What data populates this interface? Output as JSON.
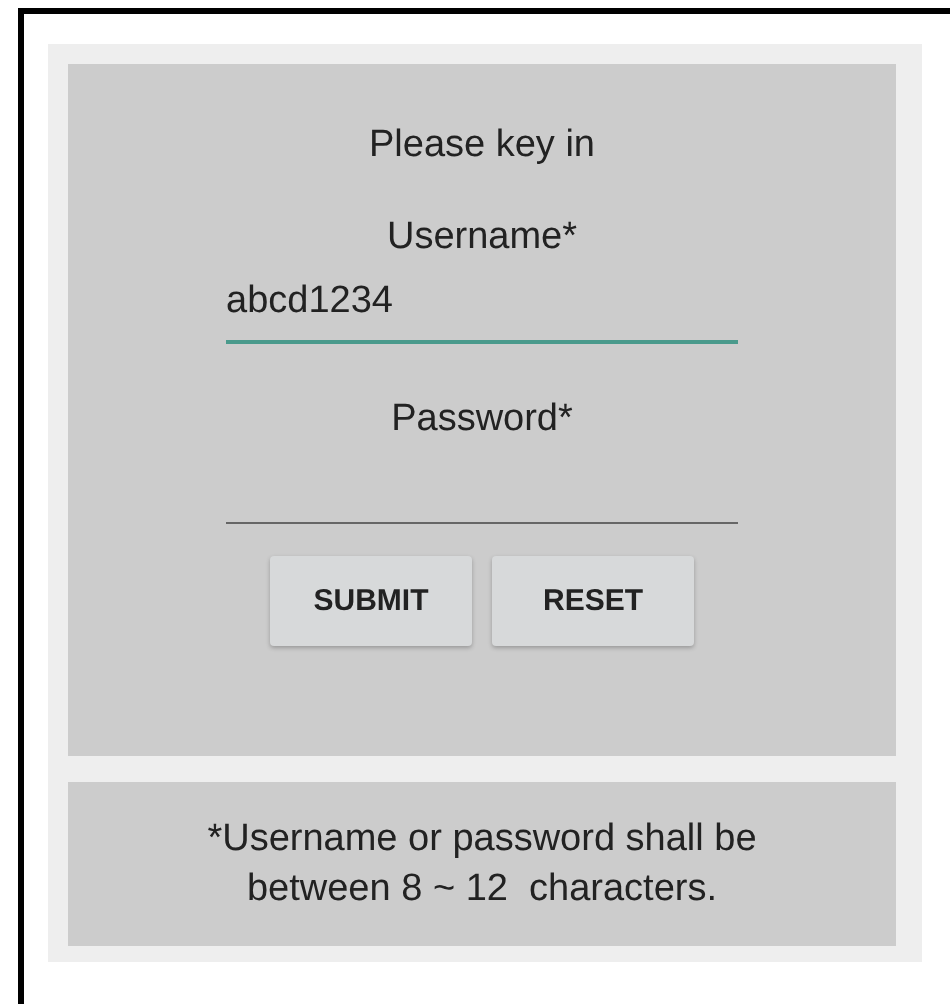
{
  "form": {
    "heading": "Please key in",
    "fields": [
      {
        "label": "Username*",
        "value": "abcd1234",
        "focused": true
      },
      {
        "label": "Password*",
        "focused": false
      }
    ],
    "buttons": [
      "SUBMIT",
      "RESET"
    ]
  },
  "note": {
    "lines": [
      "*Username or password shall be",
      "between 8 ~ 12  characters."
    ]
  }
}
